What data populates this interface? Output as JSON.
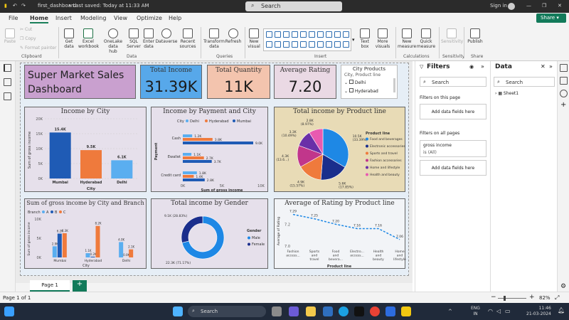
{
  "titlebar": {
    "file_name": "first_dashboard",
    "saved": "• Last saved: Today at 11:33 AM",
    "search": "Search",
    "signin": "Sign in"
  },
  "menu": {
    "items": [
      "File",
      "Home",
      "Insert",
      "Modeling",
      "View",
      "Optimize",
      "Help"
    ],
    "active": "Home",
    "share": "Share"
  },
  "ribbon": {
    "clipboard": {
      "paste": "Paste",
      "cut": "Cut",
      "copy": "Copy",
      "format_painter": "Format painter",
      "group": "Clipboard"
    },
    "data": {
      "get_data": [
        "Get",
        "data"
      ],
      "excel": [
        "Excel",
        "workbook"
      ],
      "onelake": [
        "OneLake data",
        "hub"
      ],
      "sql": [
        "SQL",
        "Server"
      ],
      "enter": [
        "Enter",
        "data"
      ],
      "dataverse": [
        "Dataverse",
        ""
      ],
      "recent": [
        "Recent",
        "sources"
      ],
      "group": "Data"
    },
    "queries": {
      "transform": [
        "Transform",
        "data"
      ],
      "refresh": [
        "Refresh",
        ""
      ],
      "group": "Queries"
    },
    "insert": {
      "new_visual": [
        "New",
        "visual"
      ],
      "text_box": [
        "Text",
        "box"
      ],
      "more_visuals": [
        "More",
        "visuals"
      ],
      "group": "Insert"
    },
    "calculations": {
      "new_measure": [
        "New",
        "measure"
      ],
      "quick_measure": [
        "Quick",
        "measure"
      ],
      "group": "Calculations"
    },
    "sensitivity": {
      "label": "Sensitivity",
      "group": "Sensitivity"
    },
    "share": {
      "publish": "Publish",
      "group": "Share"
    }
  },
  "dashboard": {
    "title": [
      "Super Market Sales",
      "Dashboard"
    ],
    "kpis": [
      {
        "label": "Total Income",
        "value": "31.39K",
        "color": "#57a8ea"
      },
      {
        "label": "Total Quantity",
        "value": "11K",
        "color": "#f3c4ae"
      },
      {
        "label": "Average Rating",
        "value": "7.20",
        "color": "#ead9e4"
      }
    ],
    "slicer": {
      "title": "City Products",
      "field": "City, Product line",
      "items": [
        "Delhi",
        "Hyderabad"
      ]
    }
  },
  "charts": {
    "income_by_city": {
      "title": "Income by City",
      "ylabel": "Sum of gross income",
      "xlabel": "City",
      "yticks": [
        "20K",
        "15K",
        "10K",
        "5K",
        "0K"
      ],
      "color": "#1f5bb5"
    },
    "income_by_payment": {
      "title": "Income by Payment and City",
      "legend_label": "City",
      "ylabel": "Payment",
      "xlabel": "Sum of gross income",
      "xticks": [
        "0K",
        "5K",
        "10K"
      ]
    },
    "income_by_product": {
      "title": "Total income by Product line",
      "legend_title": "Product line"
    },
    "income_city_branch": {
      "title": "Sum of gross income by City and Branch",
      "legend_label": "Branch",
      "ylabel": "Sum of gross income",
      "xlabel": "City",
      "yticks": [
        "10K",
        "5K",
        "0K"
      ]
    },
    "income_by_gender": {
      "title": "Total income by Gender",
      "legend_title": "Gender"
    },
    "rating_by_product": {
      "title": "Average of Rating by Product line",
      "ylabel": "Average of Rating",
      "xlabel": "Product line",
      "yticks": [
        "7.2",
        "7.0"
      ]
    }
  },
  "chart_data": [
    {
      "type": "bar",
      "title": "Income by City",
      "categories": [
        "Mumbai",
        "Hyderabad",
        "Delhi"
      ],
      "values": [
        15.4,
        9.5,
        6.1
      ],
      "labels": [
        "15.4K",
        "9.5K",
        "6.1K"
      ],
      "ylim": [
        0,
        20
      ],
      "xlabel": "City",
      "ylabel": "Sum of gross income",
      "colors": [
        "#1f5bb5",
        "#ef7a3c",
        "#5aaef0"
      ]
    },
    {
      "type": "bar",
      "orientation": "horizontal",
      "title": "Income by Payment and City",
      "categories": [
        "Cash",
        "Ewallet",
        "Credit card"
      ],
      "series": [
        {
          "name": "Delhi",
          "values": [
            1.2,
            1.1,
            1.8
          ],
          "labels": [
            "1.2K",
            "1.1K",
            "1.8K"
          ],
          "color": "#5aaef0"
        },
        {
          "name": "Hyderabad",
          "values": [
            3.8,
            2.7,
            1.4
          ],
          "labels": [
            "3.8K",
            "2.7K",
            "1.4K"
          ],
          "color": "#ef7a3c"
        },
        {
          "name": "Mumbai",
          "values": [
            9.0,
            3.7,
            2.8
          ],
          "labels": [
            "9.0K",
            "3.7K",
            "2.8K"
          ],
          "color": "#1f5bb5"
        }
      ],
      "xlim": [
        0,
        10
      ],
      "xlabel": "Sum of gross income",
      "ylabel": "Payment"
    },
    {
      "type": "pie",
      "title": "Total income by Product line",
      "legend_title": "Product line",
      "slices": [
        {
          "name": "Food and beverages",
          "value": 10.5,
          "label": "10.5K (33.39%)",
          "color": "#1e88e5"
        },
        {
          "name": "Electronic accessories",
          "value": 5.6,
          "label": "5.6K (17.85%)",
          "color": "#1a2e8c"
        },
        {
          "name": "Sports and travel",
          "value": 4.9,
          "label": "4.9K (15.57%)",
          "color": "#ef7a3c"
        },
        {
          "name": "Fashion accessories",
          "value": 4.3,
          "label": "4.3K (13.6...)",
          "color": "#c1368b"
        },
        {
          "name": "Home and lifestyle",
          "value": 3.3,
          "label": "3.3K (10.49%)",
          "color": "#6a2fa8"
        },
        {
          "name": "Health and beauty",
          "value": 2.8,
          "label": "2.8K (8.97%)",
          "color": "#e85ab0"
        }
      ]
    },
    {
      "type": "bar",
      "title": "Sum of gross income by City and Branch",
      "categories": [
        "Mumbai",
        "Hyderabad",
        "Delhi"
      ],
      "series": [
        {
          "name": "A",
          "values": [
            2.9,
            1.1,
            4.0
          ],
          "labels": [
            "2.9K",
            "1.1K",
            "4.0K"
          ],
          "color": "#5aaef0"
        },
        {
          "name": "B",
          "values": [
            6.2,
            0.2,
            0.0
          ],
          "labels": [
            "6.2K",
            "0.2K",
            "0.0K"
          ],
          "color": "#1f5bb5"
        },
        {
          "name": "C",
          "values": [
            6.3,
            8.2,
            2.1
          ],
          "labels": [
            "6.3K",
            "8.2K",
            "2.1K"
          ],
          "color": "#ef7a3c"
        }
      ],
      "ylim": [
        0,
        10
      ],
      "xlabel": "City",
      "ylabel": "Sum of gross income"
    },
    {
      "type": "pie",
      "variant": "donut",
      "title": "Total income by Gender",
      "slices": [
        {
          "name": "Male",
          "value": 22.3,
          "label": "22.3K (71.17%)",
          "color": "#1e88e5"
        },
        {
          "name": "Female",
          "value": 9.1,
          "label": "9.1K (28.83%)",
          "color": "#1a2e8c"
        }
      ],
      "legend_title": "Gender"
    },
    {
      "type": "line",
      "title": "Average of Rating by Product line",
      "categories": [
        "Fashion access...",
        "Sports and travel",
        "Food and bevera...",
        "Electro... access...",
        "Health and beauty",
        "Home and lifestyle"
      ],
      "values": [
        7.29,
        7.25,
        7.2,
        7.16,
        7.16,
        7.06
      ],
      "labels": [
        "7.29",
        "7.25",
        "7.20",
        "7.16",
        "7.16",
        "7.06"
      ],
      "ylim": [
        7.0,
        7.3
      ],
      "xlabel": "Product line",
      "ylabel": "Average of Rating",
      "color": "#1e88e5",
      "style": "dashed"
    }
  ],
  "filters": {
    "title": "Filters",
    "search": "Search",
    "this_page": "Filters on this page",
    "add_fields": "Add data fields here",
    "all_pages": "Filters on all pages",
    "field_name": "gross income",
    "field_value": "is (All)",
    "add_fields2": "Add data fields here"
  },
  "data_pane": {
    "title": "Data",
    "search": "Search",
    "table": "Sheet1"
  },
  "pages": {
    "tab": "Page 1",
    "add": "+"
  },
  "status": {
    "page_info": "Page 1 of 1",
    "zoom": "82%"
  },
  "taskbar": {
    "search": "Search",
    "lang": "ENG",
    "region": "IN",
    "time": "11:46",
    "date": "21-03-2024"
  }
}
